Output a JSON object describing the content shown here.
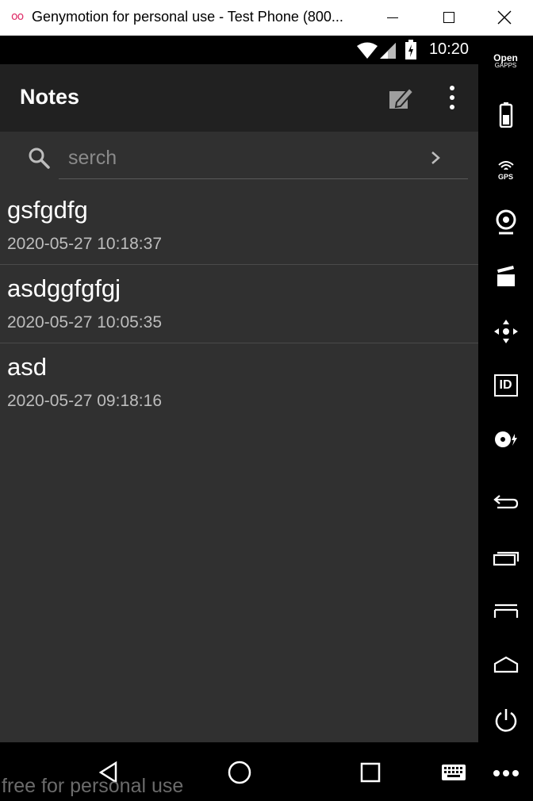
{
  "window": {
    "app_icon": "oo",
    "title": "Genymotion for personal use - Test Phone (800...",
    "controls": [
      "minimize-icon",
      "maximize-icon",
      "close-icon"
    ]
  },
  "status_bar": {
    "time": "10:20",
    "icons": [
      "wifi-icon",
      "signal-icon",
      "battery-icon"
    ]
  },
  "app_bar": {
    "title": "Notes",
    "actions": [
      "edit-note-icon",
      "more-vert-icon"
    ]
  },
  "search": {
    "placeholder": "serch",
    "value": ""
  },
  "notes": [
    {
      "title": "gsfgdfg",
      "time": "2020-05-27 10:18:37"
    },
    {
      "title": "asdggfgfgj",
      "time": "2020-05-27 10:05:35"
    },
    {
      "title": "asd",
      "time": "2020-05-27 09:18:16"
    }
  ],
  "nav_bar": {
    "buttons": [
      "back-icon",
      "home-icon",
      "recents-icon",
      "keyboard-icon"
    ]
  },
  "watermark": "free for personal use",
  "toolbar": {
    "opengapps_line1": "Open",
    "opengapps_line2": "GAPPS",
    "gps_label": "GPS",
    "id_label": "ID",
    "items": [
      "opengapps-icon",
      "battery-icon",
      "gps-icon",
      "webcam-icon",
      "capture-icon",
      "dpad-icon",
      "identifiers-icon",
      "disk-icon",
      "back-icon",
      "recent-apps-icon",
      "menu-icon",
      "home-icon",
      "power-icon",
      "more-icon"
    ]
  },
  "colors": {
    "screen_bg": "#303030",
    "appbar_bg": "#212121",
    "text_primary": "#ffffff",
    "text_secondary": "#bdbdbd",
    "accent_icon": "#e0306a"
  }
}
